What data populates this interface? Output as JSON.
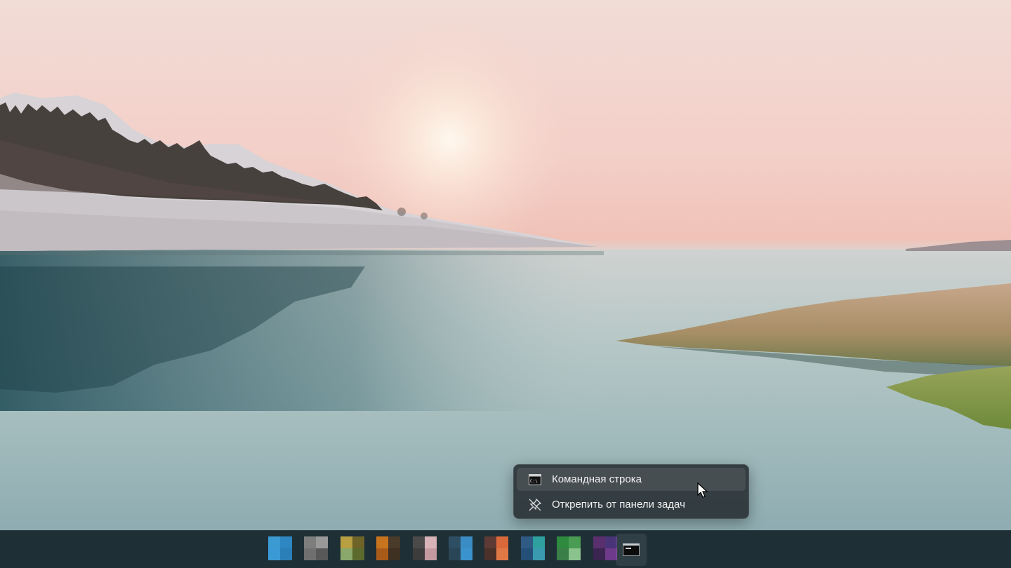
{
  "context_menu": {
    "items": [
      {
        "label": "Командная строка",
        "icon": "command-prompt-icon"
      },
      {
        "label": "Открепить от панели задач",
        "icon": "unpin-icon"
      }
    ]
  },
  "taskbar": {
    "apps": [
      {
        "icon": "taskbar-app-1-icon",
        "colors": [
          "#3b9ad1",
          "#2e86c3",
          "#3a9ad6",
          "#2b7fb8"
        ]
      },
      {
        "icon": "taskbar-app-2-icon",
        "colors": [
          "#7d7d7d",
          "#999999",
          "#6f6f6f",
          "#585858"
        ]
      },
      {
        "icon": "taskbar-app-3-icon",
        "colors": [
          "#b8a042",
          "#6e6428",
          "#8aa86c",
          "#5c6a2e"
        ]
      },
      {
        "icon": "taskbar-app-4-icon",
        "colors": [
          "#c8741e",
          "#4a3a2a",
          "#a85a18",
          "#3e3022"
        ]
      },
      {
        "icon": "taskbar-app-5-icon",
        "colors": [
          "#4a4a4a",
          "#d8b4b8",
          "#3c3c3c",
          "#c49aa0"
        ]
      },
      {
        "icon": "taskbar-app-6-icon",
        "colors": [
          "#2e4f63",
          "#3a8cc4",
          "#2a4656",
          "#3a93cc"
        ]
      },
      {
        "icon": "taskbar-app-7-icon",
        "colors": [
          "#5e3a34",
          "#d9683a",
          "#4c302a",
          "#e07845"
        ]
      },
      {
        "icon": "taskbar-app-8-icon",
        "colors": [
          "#2f5a84",
          "#2ea0a0",
          "#245078",
          "#3a9ab0"
        ]
      },
      {
        "icon": "taskbar-app-9-icon",
        "colors": [
          "#2e8a3e",
          "#4a9c52",
          "#3a7e48",
          "#8ac48c"
        ]
      },
      {
        "icon": "taskbar-app-10-icon",
        "colors": [
          "#5a2f6e",
          "#4a3478",
          "#3a2450",
          "#6e3a8a"
        ]
      }
    ],
    "pinned": {
      "icon": "command-prompt-icon"
    }
  }
}
